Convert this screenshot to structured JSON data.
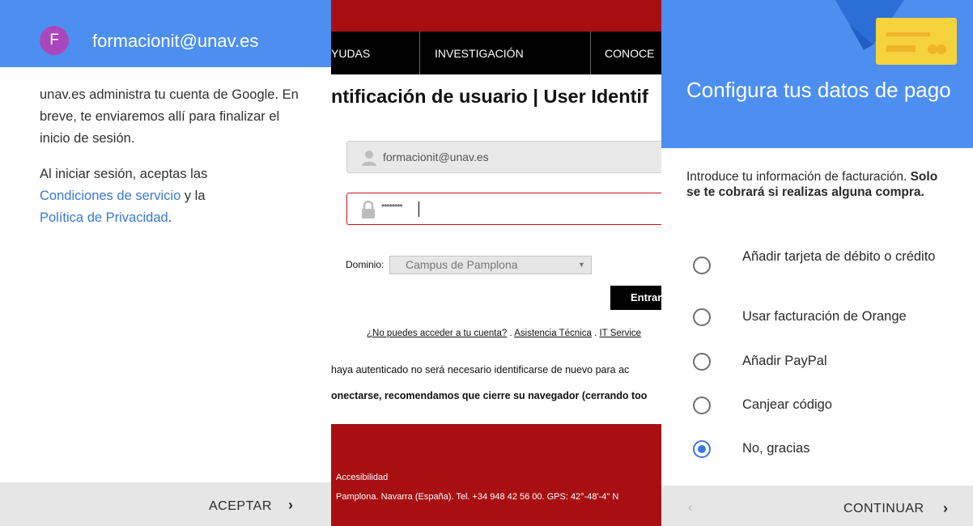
{
  "panel1": {
    "avatar_letter": "F",
    "account_email": "formacionit@unav.es",
    "paragraph1": "unav.es administra tu cuenta de Google. En breve, te enviaremos allí para finalizar el inicio de sesión.",
    "paragraph2_prefix": "Al iniciar sesión, aceptas las",
    "terms_link": "Condiciones de servicio",
    "and_text": " y la",
    "privacy_link": "Política de Privacidad",
    "period": ".",
    "accept_button": "ACEPTAR",
    "accept_chevron": "›",
    "colors": {
      "header": "#4d8ff0",
      "avatar": "#ab47bc",
      "link": "#3a78d4"
    }
  },
  "panel2": {
    "nav": [
      "YUDAS",
      "INVESTIGACIÓN",
      "CONOCE"
    ],
    "page_title": "ntificación de usuario | User Identif",
    "username_value": "formacionit@unav.es",
    "password_mask": "••••••••",
    "domain_label": "Dominio:",
    "domain_selected": "Campus de Pamplona",
    "enter_button": "Entrar",
    "links": {
      "cant_access": "¿No puedes acceder a tu cuenta?",
      "sep1": " . ",
      "support": "Asistencia Técnica",
      "sep2": " . ",
      "it_services": "IT Service"
    },
    "info_line": "haya autenticado no será necesario identificarse de nuevo para ac",
    "warning_line": "onectarse, recomendamos que cierre su navegador (cerrando too",
    "footer_accessibility": "Accesibilidad",
    "footer_address": "Pamplona. Navarra (España). Tel. +34 948 42 56 00. GPS: 42°-48'-4\" N",
    "colors": {
      "brand_red": "#a80f13",
      "nav": "#000000",
      "error_border": "#c8111a"
    }
  },
  "panel3": {
    "title": "Configura tus datos de pago",
    "intro_plain": "Introduce tu información de facturación. ",
    "intro_bold": "Solo se te cobrará si realizas alguna compra.",
    "options": [
      {
        "label": "Añadir tarjeta de débito o crédito",
        "selected": false
      },
      {
        "label": "Usar facturación de Orange",
        "selected": false
      },
      {
        "label": "Añadir PayPal",
        "selected": false
      },
      {
        "label": "Canjear código",
        "selected": false
      },
      {
        "label": "No, gracias",
        "selected": true
      }
    ],
    "back_chevron": "‹",
    "continue_button": "CONTINUAR",
    "continue_chevron": "›",
    "colors": {
      "header": "#4d8ff0",
      "radio_on": "#3b78e7",
      "card": "#f6d23d"
    }
  }
}
